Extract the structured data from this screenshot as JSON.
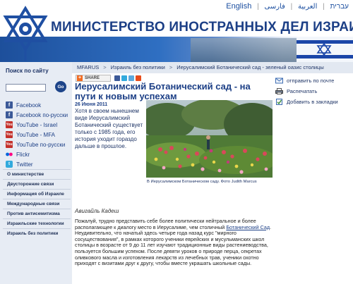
{
  "header": {
    "title": "МИНИСТЕРСТВО ИНОСТРАННЫХ ДЕЛ ИЗРАИЛЯ",
    "languages": [
      "English",
      "עברית",
      "العربية",
      "فارسی"
    ]
  },
  "sidebar": {
    "search_label": "Поиск по сайту",
    "search_value": "",
    "go_label": "Go",
    "social": [
      {
        "label": "Facebook",
        "icon": "facebook-icon",
        "glyph": "f"
      },
      {
        "label": "Facebook по-русски",
        "icon": "facebook-icon",
        "glyph": "f"
      },
      {
        "label": "YouTube - Israel",
        "icon": "youtube-icon",
        "glyph": "You"
      },
      {
        "label": "YouTube - MFA",
        "icon": "youtube-icon",
        "glyph": "You"
      },
      {
        "label": "YouTube по-русски",
        "icon": "youtube-icon",
        "glyph": "You"
      },
      {
        "label": "Flickr",
        "icon": "flickr-icon",
        "glyph": ""
      },
      {
        "label": "Twitter",
        "icon": "twitter-icon",
        "glyph": "t"
      }
    ],
    "nav": [
      "О министерстве",
      "Двусторонние связи",
      "Информация об Израиле",
      "Международные связи",
      "Против антисемитизма",
      "Израильские технологии",
      "Израиль без политики"
    ]
  },
  "breadcrumb": [
    "MFARUS",
    "Израиль без политики",
    "Иерусалимский Ботанический сад - зеленый оазис столицы"
  ],
  "article": {
    "share_label": "SHARE",
    "headline": "Иерусалимский Ботанический сад - на пути к новым успехам",
    "date": "26 Июня 2011",
    "lead": "Хотя в своем нынешнем виде Иерусалимский Ботанический существует только с 1985 года, его история уходит гораздо дальше в прошлое.",
    "caption": "В Иерусалимском Ботаническом саду. Фото Judith Marcus",
    "author": "Авигайль Кадеш",
    "body_before_link": "Пожалуй, трудно представить себе более политически нейтральное и более располагающее к диалогу место в Иерусалиме, чем столичный ",
    "body_link": "Ботанический Сад",
    "body_after_link": ". Неудивительно, что начатый здесь четыре года назад курс \"мирного сосуществования\", в рамках которого ученики еврейских и мусульманских школ столицы в возрасте от 9 до 11 лет изучают традиционные виды растениеводства, пользуется большим успехом. После девяти уроков о природе перца, секретах оливкового масла и изготовления лекарств из лечебных трав, ученики охотно приходят с визитами друг к другу, чтобы вместе украшать школьные сады."
  },
  "tools": [
    {
      "label": "отправить по почте",
      "icon": "email-icon"
    },
    {
      "label": "Распечатать",
      "icon": "print-icon"
    },
    {
      "label": "Добавить в закладки",
      "icon": "bookmark-icon"
    }
  ],
  "colors": {
    "brand_blue": "#1c3f86",
    "sidebar_bg": "#e7ecf4",
    "youtube_red": "#c4302b",
    "facebook_blue": "#3b5998"
  }
}
